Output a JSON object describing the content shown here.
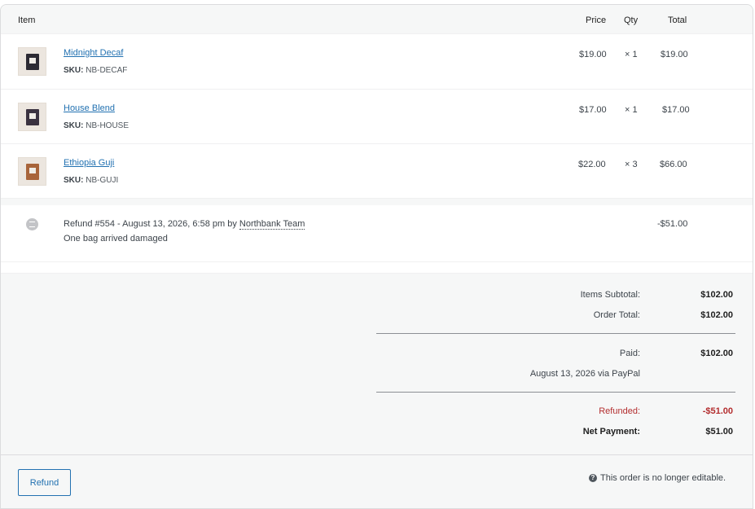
{
  "header": {
    "item": "Item",
    "price": "Price",
    "qty": "Qty",
    "total": "Total"
  },
  "items": [
    {
      "name": "Midnight Decaf",
      "sku_label": "SKU:",
      "sku": "NB-DECAF",
      "price": "$19.00",
      "qty": "× 1",
      "total": "$19.00",
      "bag_color": "#2c2a33"
    },
    {
      "name": "House Blend",
      "sku_label": "SKU:",
      "sku": "NB-HOUSE",
      "price": "$17.00",
      "qty": "× 1",
      "total": "$17.00",
      "bag_color": "#3a3240"
    },
    {
      "name": "Ethiopia Guji",
      "sku_label": "SKU:",
      "sku": "NB-GUJI",
      "price": "$22.00",
      "qty": "× 3",
      "total": "$66.00",
      "bag_color": "#a8643a"
    }
  ],
  "refund": {
    "text": "Refund #554 - August 13, 2026, 6:58 pm by",
    "author": "Northbank Team",
    "reason": "One bag arrived damaged",
    "amount": "-$51.00"
  },
  "totals": {
    "items_subtotal_label": "Items Subtotal:",
    "items_subtotal": "$102.00",
    "order_total_label": "Order Total:",
    "order_total": "$102.00",
    "paid_label": "Paid:",
    "paid": "$102.00",
    "paid_note": "August 13, 2026 via PayPal",
    "refunded_label": "Refunded:",
    "refunded": "-$51.00",
    "net_payment_label": "Net Payment:",
    "net_payment": "$51.00"
  },
  "footer": {
    "refund_button": "Refund",
    "not_editable_note": "This order is no longer editable."
  },
  "colors": {
    "link": "#2271b1",
    "refunded": "#b32d2e"
  }
}
